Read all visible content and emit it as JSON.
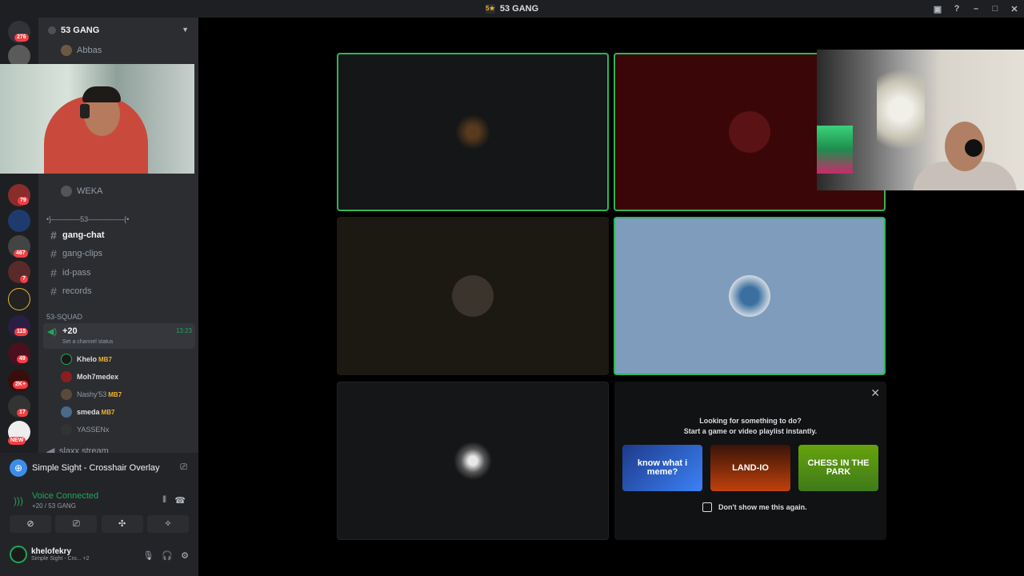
{
  "window": {
    "title": "53 GANG",
    "title_icon": "5★"
  },
  "guild_badges": [
    "276",
    "79",
    "467",
    "7",
    "115",
    "49",
    "2K+",
    "17",
    "NEW"
  ],
  "server": {
    "name": "53 GANG"
  },
  "channels_top": [
    {
      "label": "Abbas"
    },
    {
      "label": "WEKA"
    }
  ],
  "divider_label": "•}————53—————{•",
  "text_channels": [
    {
      "label": "gang-chat",
      "active": true
    },
    {
      "label": "gang-clips"
    },
    {
      "label": "id-pass"
    },
    {
      "label": "records"
    }
  ],
  "category": {
    "label": "53-SQUAD"
  },
  "voice_channel": {
    "label": "+20",
    "time": "13:23",
    "status": "Set a channel status"
  },
  "voice_members": [
    {
      "name": "Khelo",
      "tag": "MB7"
    },
    {
      "name": "Moh7medex",
      "tag": ""
    },
    {
      "name": "Nashy'53",
      "tag": "MB7"
    },
    {
      "name": "smeda",
      "tag": "MB7"
    },
    {
      "name": "YASSENx",
      "tag": ""
    }
  ],
  "next_channel": {
    "label": "slaxx stream"
  },
  "activity": {
    "label": "Simple Sight - Crosshair Overlay"
  },
  "voice": {
    "status": "Voice Connected",
    "channel": "+20 / 53 GANG"
  },
  "user": {
    "name": "khelofekry",
    "status": "Simple Sight - Cro...",
    "extra": "+2"
  },
  "activity_panel": {
    "title": "Looking for something to do?",
    "subtitle": "Start a game or video playlist instantly.",
    "games": [
      {
        "label": "know what i meme?"
      },
      {
        "label": "LAND-IO"
      },
      {
        "label": "CHESS IN THE PARK"
      }
    ],
    "checkbox": "Don't show me this again."
  },
  "colors": {
    "accent": "#23a55a",
    "speaking": "#2fb45a",
    "badge": "#f23f43"
  }
}
